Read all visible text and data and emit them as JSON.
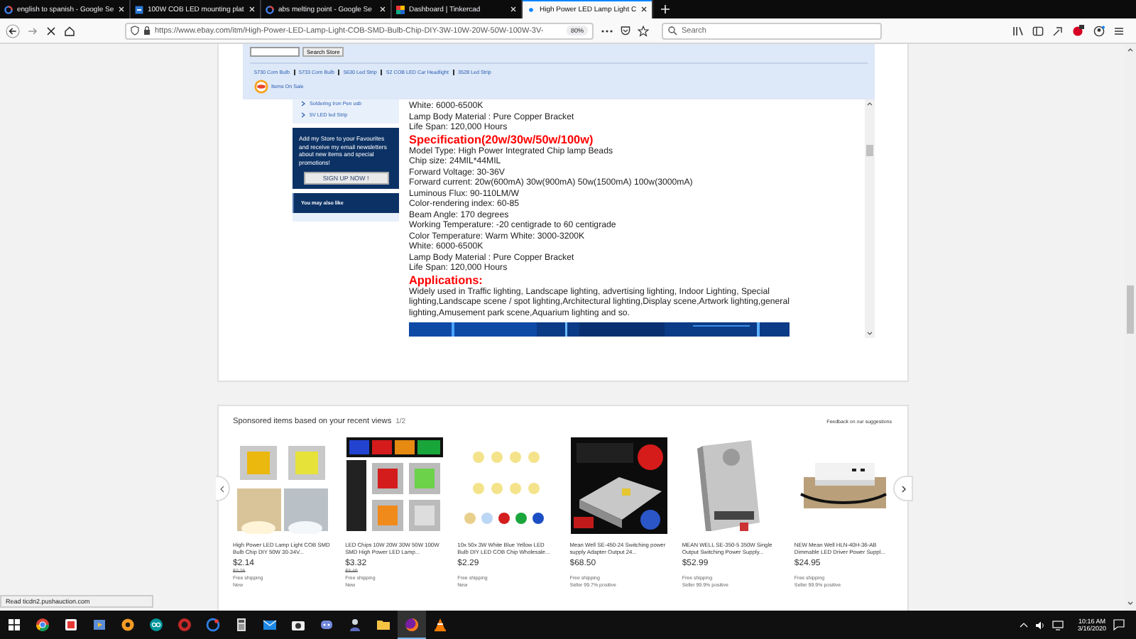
{
  "browser": {
    "tabs": [
      {
        "title": "english to spanish - Google Se",
        "selected": false
      },
      {
        "title": "100W COB LED mounting plat",
        "selected": false
      },
      {
        "title": "abs melting point - Google Se",
        "selected": false
      },
      {
        "title": "Dashboard | Tinkercad",
        "selected": false
      },
      {
        "title": "High Power LED Lamp Light C",
        "selected": true
      }
    ],
    "url": "https://www.ebay.com/itm/High-Power-LED-Lamp-Light-COB-SMD-Bulb-Chip-DIY-3W-10W-20W-50W-100W-3V-",
    "zoom": "80%",
    "search": {
      "placeholder": "Search"
    },
    "status": "Read ticdn2.pushauction.com"
  },
  "store_header": {
    "search_button": "Search Store",
    "links": [
      "5730 Corn Bulb",
      "5733 Corn Bulb",
      "5630 Led Strip",
      "S2 COB LED Car Headlight",
      "3528 Led Strip"
    ],
    "sale_label": "Items On Sale"
  },
  "sidebar": {
    "links": [
      "Soldering Iron Pen usb",
      "5V LED led Strip"
    ],
    "promo_text": "Add my Store to your Favourites and receive my email newsletters about new items and special promotions!",
    "signup_button": "SIGN UP NOW !",
    "also_like": "You may also like"
  },
  "description": [
    {
      "kind": "line",
      "text": "White: 6000-6500K"
    },
    {
      "kind": "line",
      "text": "Lamp Body Material : Pure Copper Bracket"
    },
    {
      "kind": "line",
      "text": "Life Span: 120,000 Hours"
    },
    {
      "kind": "heading",
      "text": "Specification(20w/30w/50w/100w)"
    },
    {
      "kind": "line",
      "text": "Model Type: High Power Integrated Chip lamp Beads"
    },
    {
      "kind": "line",
      "text": "Chip size: 24MIL*44MIL"
    },
    {
      "kind": "line",
      "text": "Forward Voltage: 30-36V"
    },
    {
      "kind": "line",
      "text": "Forward current: 20w(600mA) 30w(900mA) 50w(1500mA) 100w(3000mA)"
    },
    {
      "kind": "line",
      "text": "Luminous Flux: 90-110LM/W"
    },
    {
      "kind": "line",
      "text": "Color-rendering index: 60-85"
    },
    {
      "kind": "line",
      "text": "Beam Angle: 170 degrees"
    },
    {
      "kind": "line",
      "text": "Working Temperature: -20 centigrade to 60 centigrade"
    },
    {
      "kind": "line",
      "text": "Color Temperature: Warm White: 3000-3200K"
    },
    {
      "kind": "line",
      "text": "White: 6000-6500K"
    },
    {
      "kind": "line",
      "text": "Lamp Body Material : Pure Copper Bracket"
    },
    {
      "kind": "line",
      "text": "Life Span: 120,000 Hours"
    },
    {
      "kind": "heading",
      "text": "Applications:"
    },
    {
      "kind": "paragraph",
      "text": "Widely used in Traffic lighting, Landscape lighting, advertising lighting, Indoor Lighting, Special lighting,Landscape scene / spot lighting,Architectural lighting,Display scene,Artwork lighting,general lighting,Amusement park scene,Aquarium lighting and so."
    }
  ],
  "sponsored": {
    "title": "Sponsored items based on your recent views",
    "page": "1/2",
    "feedback": "Feedback on our suggestions",
    "items": [
      {
        "title": "High Power LED Lamp Light COB SMD Bulb Chip DIY 50W 30-34V...",
        "price": "$2.14",
        "was_price": "$2.25",
        "shipping": "Free shipping",
        "note": "New"
      },
      {
        "title": "LED Chips 10W 20W 30W 50W 100W SMD High Power LED Lamp...",
        "price": "$3.32",
        "was_price": "$3.49",
        "shipping": "Free shipping",
        "note": "New"
      },
      {
        "title": "10x 50x 3W White Blue Yellow LED Bulb DIY LED COB Chip Wholesale...",
        "price": "$2.29",
        "shipping": "Free shipping",
        "note": "New"
      },
      {
        "title": "Mean Well SE-450-24 Switching power supply Adapter Output 24...",
        "price": "$68.50",
        "shipping": "Free shipping",
        "note": "Seller 99.7% positive"
      },
      {
        "title": "MEAN WELL SE-350-5 350W Single Output Switching Power Supply...",
        "price": "$52.99",
        "shipping": "Free shipping",
        "note": "Seller 99.9% positive"
      },
      {
        "title": "NEW Mean Well HLN-40H-36-AB Dimmable LED Driver Power Suppl...",
        "price": "$24.95",
        "shipping": "Free shipping",
        "note": "Seller 99.9% positive"
      }
    ]
  },
  "taskbar": {
    "time": "10:16 AM",
    "date": "3/16/2020"
  }
}
